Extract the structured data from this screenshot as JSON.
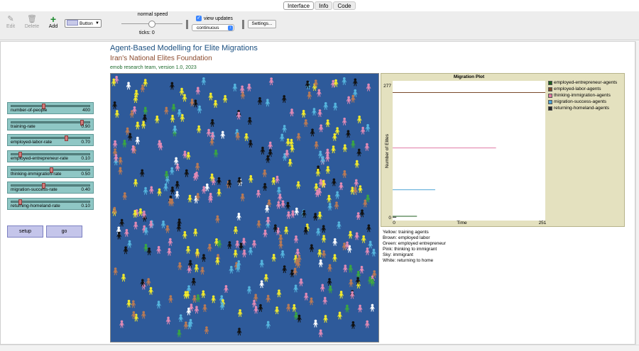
{
  "tabs": [
    {
      "label": "Interface",
      "active": true
    },
    {
      "label": "Info",
      "active": false
    },
    {
      "label": "Code",
      "active": false
    }
  ],
  "toolbar": {
    "edit": "Edit",
    "delete": "Delete",
    "add": "Add",
    "widget_type": "Button",
    "speed_label": "normal speed",
    "ticks_label": "ticks: 0",
    "view_updates_label": "view updates",
    "view_updates_checked": true,
    "update_mode": "continuous",
    "settings_label": "Settings..."
  },
  "header": {
    "title": "Agent-Based Modelling for Elite Migrations",
    "subtitle": "Iran's National Elites Foundation",
    "version": "emob research team, version 1.0, 2023"
  },
  "sliders": [
    {
      "label": "number-of-people",
      "value": "400",
      "fraction": 0.4
    },
    {
      "label": "training-rate",
      "value": "0.90",
      "fraction": 0.9
    },
    {
      "label": "employed-labor-rate",
      "value": "0.70",
      "fraction": 0.7
    },
    {
      "label": "employed-entrepreneur-rate",
      "value": "0.10",
      "fraction": 0.1
    },
    {
      "label": "thinking-immigration-rate",
      "value": "0.50",
      "fraction": 0.5
    },
    {
      "label": "migration-success-rate",
      "value": "0.40",
      "fraction": 0.4
    },
    {
      "label": "returning-homeland-rate",
      "value": "0.10",
      "fraction": 0.1
    }
  ],
  "buttons": {
    "setup": "setup",
    "go": "go"
  },
  "chart_data": {
    "type": "line",
    "title": "Migration Plot",
    "xlabel": "Time",
    "ylabel": "Number of Elites",
    "xlim": [
      0,
      251
    ],
    "ylim": [
      0,
      277
    ],
    "x_tick_labels": [
      "0",
      "251"
    ],
    "y_tick_labels": [
      "0",
      "277"
    ],
    "grid": false,
    "legend": "right",
    "series": [
      {
        "name": "employed-entrepreneur-agents",
        "color": "#1e5e1e",
        "x": [
          0,
          40
        ],
        "y": [
          3,
          3
        ]
      },
      {
        "name": "employed-labor-agents",
        "color": "#7a4a2a",
        "x": [
          0,
          251
        ],
        "y": [
          260,
          260
        ]
      },
      {
        "name": "thinking-immigration-agents",
        "color": "#e07aa4",
        "x": [
          0,
          170
        ],
        "y": [
          145,
          145
        ]
      },
      {
        "name": "migration-success-agents",
        "color": "#4fa6d6",
        "x": [
          0,
          70
        ],
        "y": [
          58,
          58
        ]
      },
      {
        "name": "returning-homeland-agents",
        "color": "#2b2b2b",
        "x": [
          0,
          6
        ],
        "y": [
          1,
          1
        ]
      }
    ]
  },
  "notes": [
    "Yellow: training agents",
    "Brown: employed labor",
    "Green: employed entrepreneur",
    "Pink: thinking to immigrant",
    "Sky: immigrant",
    "White: returning to home"
  ],
  "world": {
    "background": "#2e5a9a",
    "agent_colors": {
      "training": "#f2ea2c",
      "labor": "#b97a55",
      "entrepreneur": "#3aa640",
      "thinking": "#e28ab5",
      "immigrant": "#55b5de",
      "returning": "#ffffff",
      "other": "#111111"
    }
  }
}
